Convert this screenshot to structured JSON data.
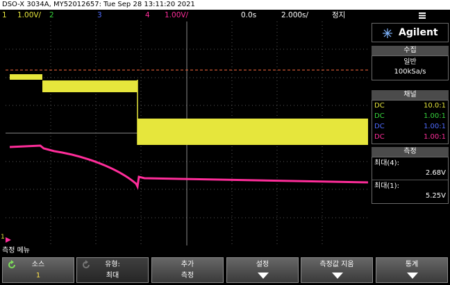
{
  "title": "DSO-X 3034A, MY52012657: Tue Sep 28 13:11:20 2021",
  "status": {
    "ch1_num": "1",
    "ch1_scale": "1.00V/",
    "ch2_num": "2",
    "ch3_num": "3",
    "ch4_num": "4",
    "ch4_scale": "1.00V/",
    "delay": "0.0s",
    "timebase": "2.000s/",
    "run_state": "정지",
    "menu_icon": "menu-icon"
  },
  "brand": "Agilent",
  "acquisition": {
    "title": "수집",
    "mode": "일반",
    "rate": "100kSa/s"
  },
  "channels": {
    "title": "채널",
    "rows": [
      {
        "coupling": "DC",
        "probe": "10.0:1",
        "color": "#e6e63c"
      },
      {
        "coupling": "DC",
        "probe": "1.00:1",
        "color": "#37d53c"
      },
      {
        "coupling": "DC",
        "probe": "1.00:1",
        "color": "#4f6bff"
      },
      {
        "coupling": "DC",
        "probe": "1.00:1",
        "color": "#ff2d9a"
      }
    ]
  },
  "measure": {
    "title": "측정",
    "items": [
      {
        "label": "최대(4):",
        "value": "2.68V"
      },
      {
        "label": "최대(1):",
        "value": "5.25V"
      }
    ]
  },
  "menu_title": "측정 메뉴",
  "softkeys": [
    {
      "line1": "소스",
      "line2": "1"
    },
    {
      "line1": "유형:",
      "line2": "최대"
    },
    {
      "line1": "추가",
      "line2": "측정"
    },
    {
      "line1": "설정",
      "line2": ""
    },
    {
      "line1": "측정값 지움",
      "line2": ""
    },
    {
      "line1": "통계",
      "line2": ""
    }
  ],
  "ch1_marker": "1",
  "colors": {
    "ch1": "#e6e63c",
    "ch2": "#37d53c",
    "ch3": "#4f6bff",
    "ch4": "#ff2d9a",
    "trigger_line": "#ff6a3c"
  }
}
